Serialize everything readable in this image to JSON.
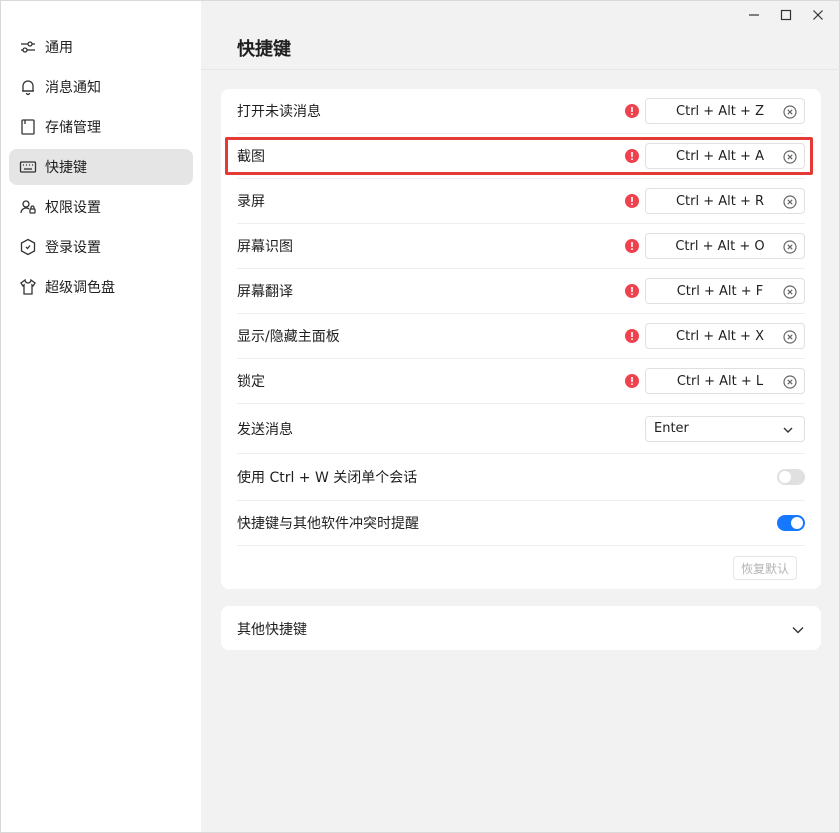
{
  "window": {
    "controls": [
      "minimize-icon",
      "maximize-icon",
      "close-icon"
    ]
  },
  "sidebar": {
    "items": [
      {
        "label": "通用",
        "icon": "sliders-icon",
        "active": false
      },
      {
        "label": "消息通知",
        "icon": "bell-icon",
        "active": false
      },
      {
        "label": "存储管理",
        "icon": "storage-icon",
        "active": false
      },
      {
        "label": "快捷键",
        "icon": "keyboard-icon",
        "active": true
      },
      {
        "label": "权限设置",
        "icon": "user-lock-icon",
        "active": false
      },
      {
        "label": "登录设置",
        "icon": "hexagon-shield-icon",
        "active": false
      },
      {
        "label": "超级调色盘",
        "icon": "tshirt-icon",
        "active": false
      }
    ]
  },
  "main": {
    "title": "快捷键",
    "shortcuts": [
      {
        "label": "打开未读消息",
        "value": "Ctrl + Alt + Z",
        "warning": true
      },
      {
        "label": "截图",
        "value": "Ctrl + Alt + A",
        "warning": true,
        "highlighted": true
      },
      {
        "label": "录屏",
        "value": "Ctrl + Alt + R",
        "warning": true
      },
      {
        "label": "屏幕识图",
        "value": "Ctrl + Alt + O",
        "warning": true
      },
      {
        "label": "屏幕翻译",
        "value": "Ctrl + Alt + F",
        "warning": true
      },
      {
        "label": "显示/隐藏主面板",
        "value": "Ctrl + Alt + X",
        "warning": true
      },
      {
        "label": "锁定",
        "value": "Ctrl + Alt + L",
        "warning": true
      }
    ],
    "send_message": {
      "label": "发送消息",
      "value": "Enter"
    },
    "close_session": {
      "label": "使用 Ctrl + W 关闭单个会话",
      "enabled": false
    },
    "conflict_alert": {
      "label": "快捷键与其他软件冲突时提醒",
      "enabled": true
    },
    "restore_default_label": "恢复默认",
    "other_shortcuts_label": "其他快捷键"
  },
  "colors": {
    "accent": "#1677ff",
    "warning": "#f0424e",
    "highlight": "#e53935"
  }
}
